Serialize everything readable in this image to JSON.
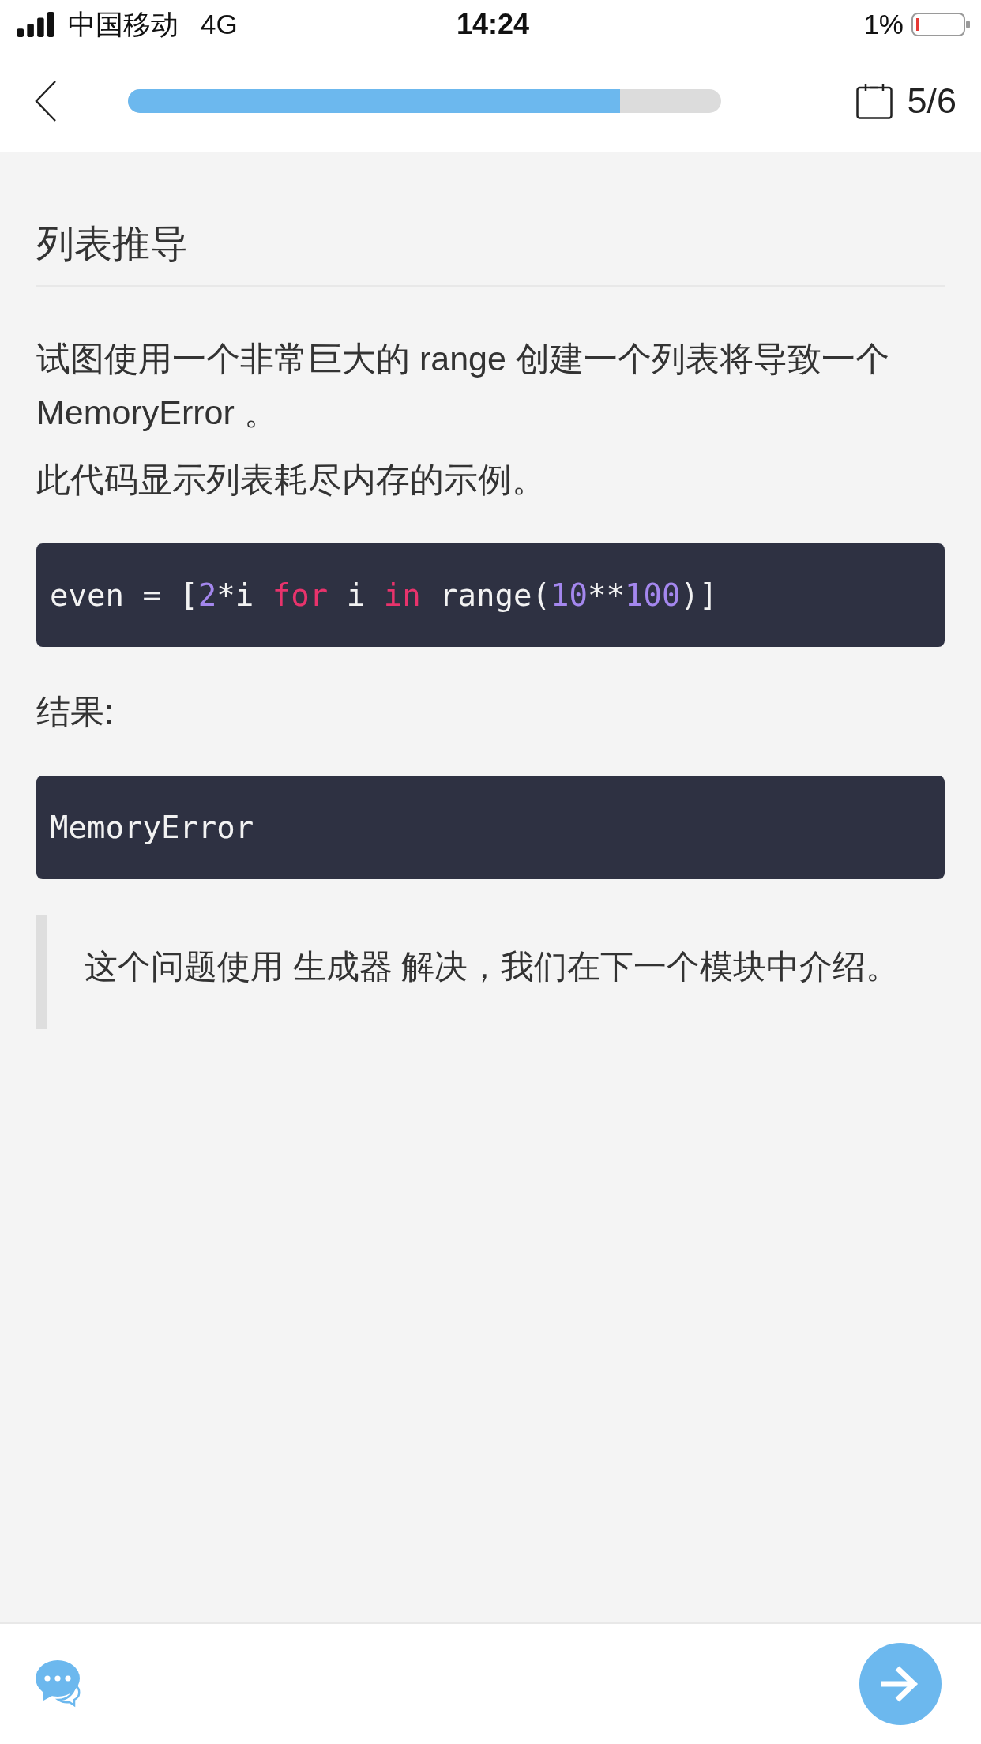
{
  "status_bar": {
    "carrier": "中国移动",
    "network": "4G",
    "time": "14:24",
    "battery": "1%"
  },
  "header": {
    "progress": {
      "level": 0.83
    },
    "counter": "5/6"
  },
  "title": "列表推导",
  "blocks": [
    {
      "kind": "paragraph",
      "text": "试图使用一个非常巨大的 range 创建一个列表将导致一个 MemoryError 。"
    },
    {
      "kind": "paragraph",
      "text": "此代码显示列表耗尽内存的示例。"
    },
    {
      "kind": "code",
      "tokens": [
        {
          "text": "even = [",
          "kind": "plain"
        },
        {
          "text": "2",
          "kind": "number"
        },
        {
          "text": "*i ",
          "kind": "plain"
        },
        {
          "text": "for",
          "kind": "keyword"
        },
        {
          "text": " i ",
          "kind": "plain"
        },
        {
          "text": "in",
          "kind": "keyword"
        },
        {
          "text": " range(",
          "kind": "plain"
        },
        {
          "text": "10",
          "kind": "number"
        },
        {
          "text": "**",
          "kind": "plain"
        },
        {
          "text": "100",
          "kind": "number"
        },
        {
          "text": ")]",
          "kind": "plain"
        }
      ]
    },
    {
      "kind": "paragraph",
      "text": "结果:"
    },
    {
      "kind": "code",
      "tokens": [
        {
          "text": "MemoryError",
          "kind": "plain"
        }
      ]
    },
    {
      "kind": "quote",
      "text": "这个问题使用 生成器 解决，我们在下一个模块中介绍。"
    }
  ]
}
